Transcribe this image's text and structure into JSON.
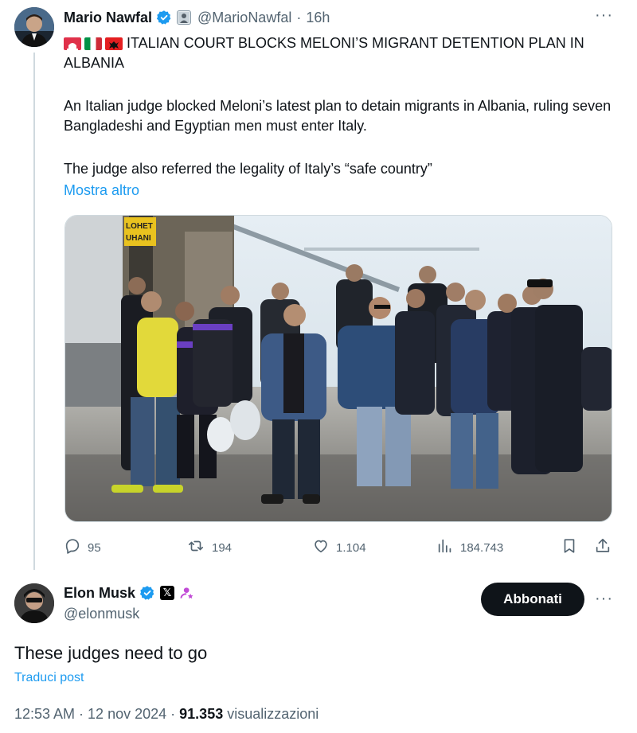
{
  "tweet": {
    "author_name": "Mario Nawfal",
    "author_handle": "@MarioNawfal",
    "separator": "·",
    "time": "16h",
    "title_text": "ITALIAN COURT BLOCKS MELONI’S MIGRANT DETENTION PLAN IN ALBANIA",
    "body_paragraph_1": "An Italian judge blocked Meloni’s latest plan to detain migrants in Albania, ruling seven Bangladeshi and Egyptian men must enter Italy.",
    "body_paragraph_2": "The judge also referred the legality of Italy’s “safe country”",
    "show_more": "Mostra altro",
    "image_sign_text_1": "LOHET",
    "image_sign_text_2": "UHANI",
    "stats": {
      "replies": "95",
      "reposts": "194",
      "likes": "1.104",
      "views": "184.743"
    },
    "more_icon": "more-horizontal-icon",
    "verified_color": "#1d9bf0"
  },
  "reply": {
    "author_name": "Elon Musk",
    "author_handle": "@elonmusk",
    "follow_label": "Abbonati",
    "text": "These judges need to go",
    "translate_label": "Traduci post",
    "timestamp": "12:53 AM · 12 nov 2024 ·",
    "views_count": "91.353",
    "views_label": "visualizzazioni"
  },
  "colors": {
    "accent": "#1d9bf0",
    "text_primary": "#0f1419",
    "text_secondary": "#536471",
    "button_dark": "#0f1419"
  }
}
